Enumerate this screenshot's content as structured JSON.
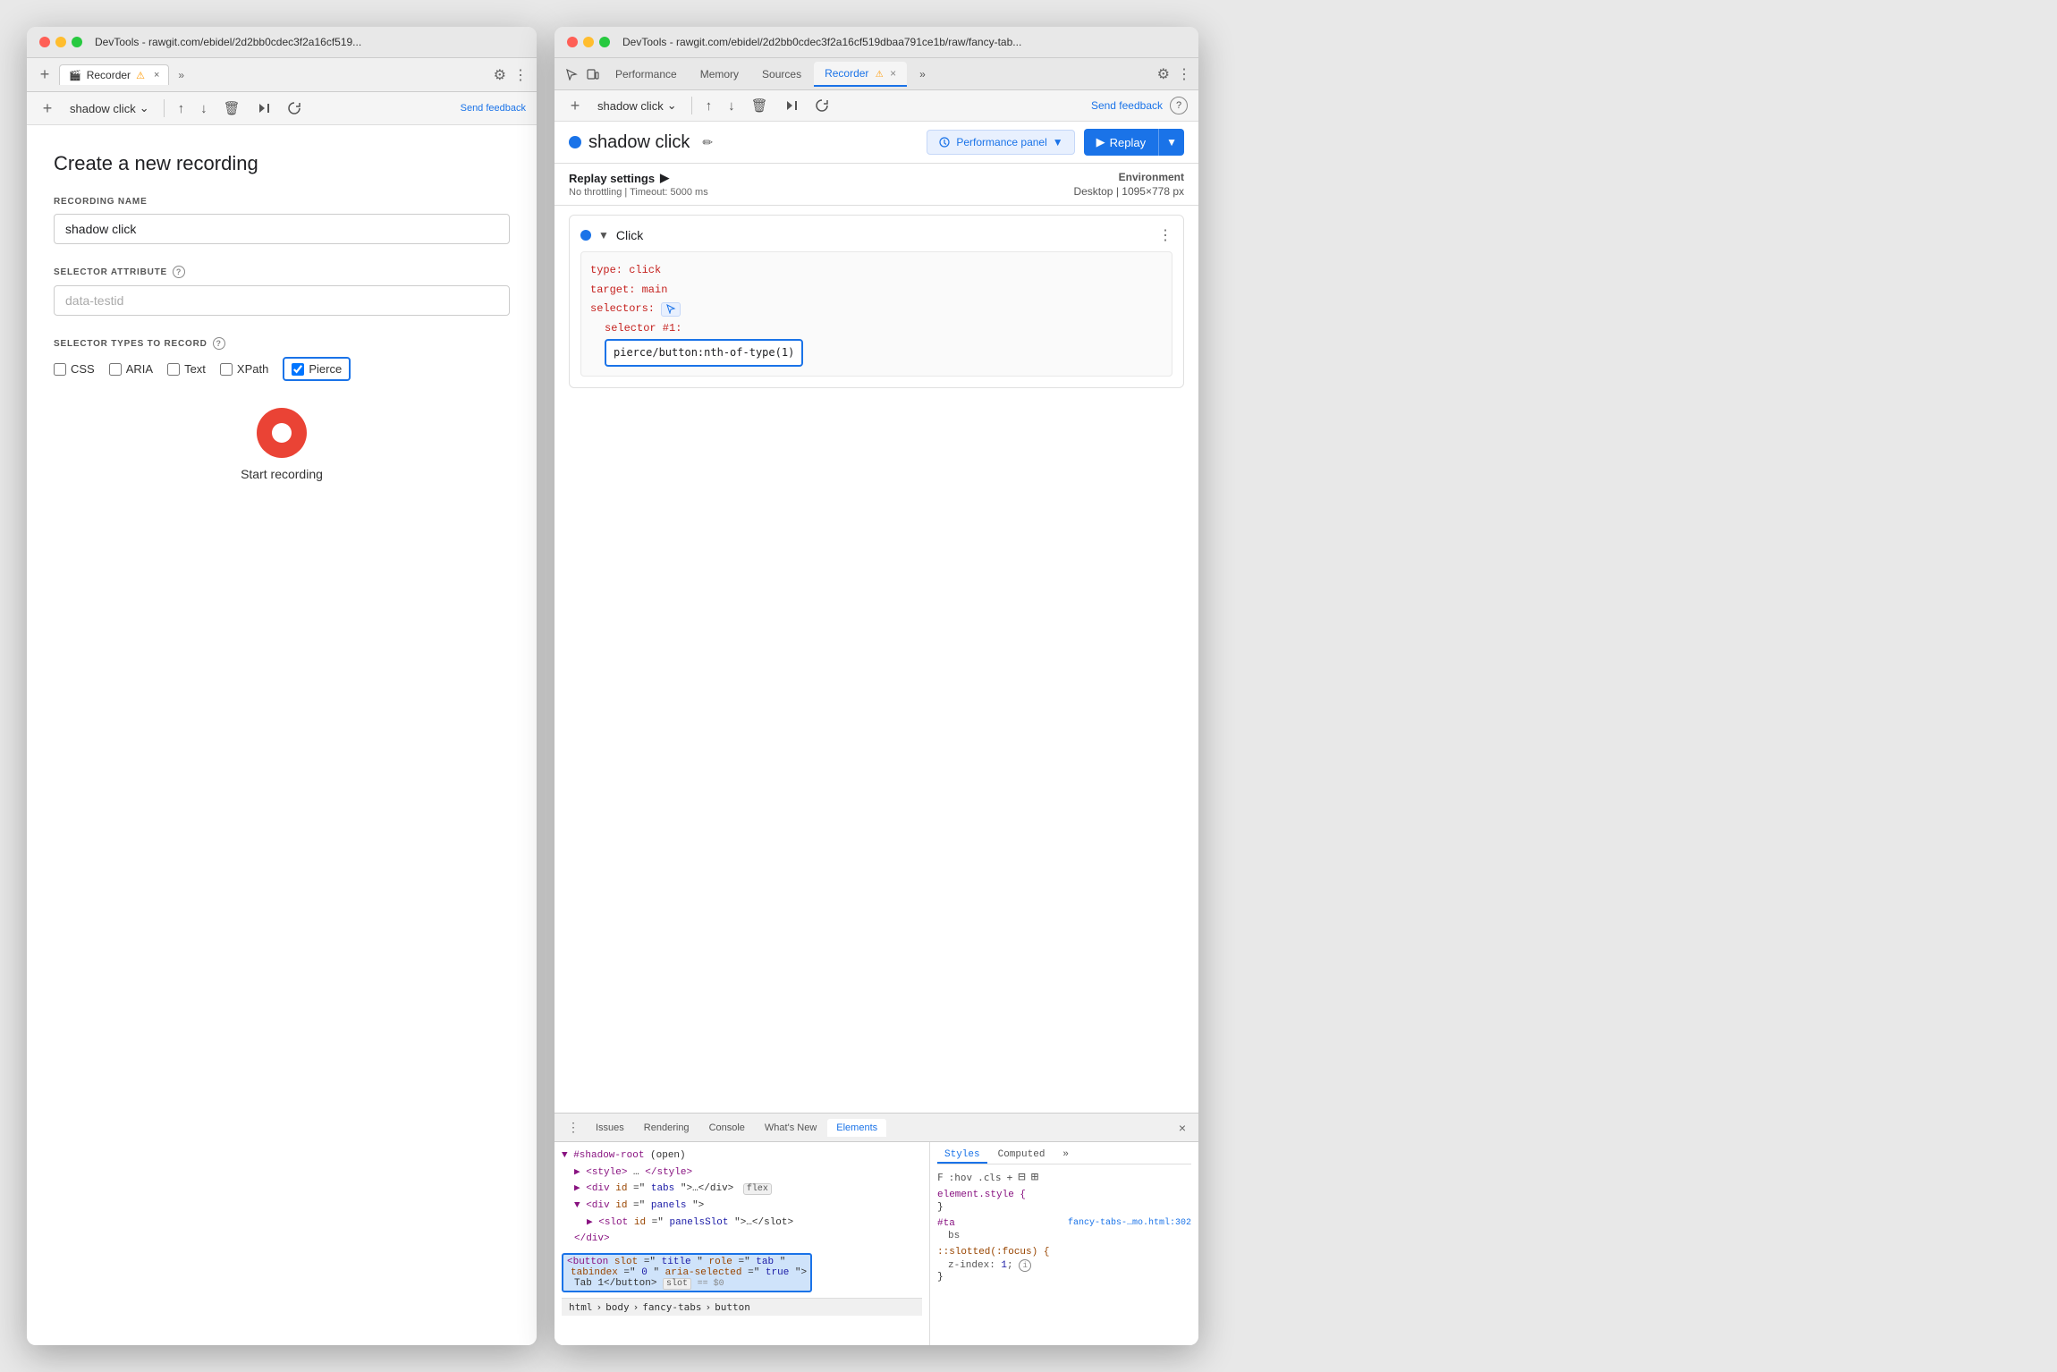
{
  "left_window": {
    "titlebar": "DevTools - rawgit.com/ebidel/2d2bb0cdec3f2a16cf519...",
    "tab_label": "Recorder",
    "tab_icon": "🎬",
    "recording_name_selector": "shadow click",
    "send_feedback": "Send\nfeedback",
    "create_title": "Create a new recording",
    "recording_name_label": "RECORDING NAME",
    "recording_name_value": "shadow click",
    "selector_attribute_label": "SELECTOR ATTRIBUTE",
    "selector_attribute_placeholder": "data-testid",
    "selector_types_label": "SELECTOR TYPES TO RECORD",
    "checkboxes": [
      {
        "id": "css",
        "label": "CSS",
        "checked": false
      },
      {
        "id": "aria",
        "label": "ARIA",
        "checked": false
      },
      {
        "id": "text",
        "label": "Text",
        "checked": false
      },
      {
        "id": "xpath",
        "label": "XPath",
        "checked": false
      },
      {
        "id": "pierce",
        "label": "Pierce",
        "checked": true
      }
    ],
    "start_recording_label": "Start recording"
  },
  "right_window": {
    "titlebar": "DevTools - rawgit.com/ebidel/2d2bb0cdec3f2a16cf519dbaa791ce1b/raw/fancy-tab...",
    "devtools_tabs": [
      "Performance",
      "Memory",
      "Sources",
      "Recorder",
      "»"
    ],
    "active_tab": "Recorder",
    "send_feedback": "Send feedback",
    "recording_name": "shadow click",
    "perf_panel_label": "Performance panel",
    "replay_label": "Replay",
    "replay_settings_title": "Replay settings",
    "no_throttling": "No throttling",
    "timeout": "Timeout: 5000 ms",
    "environment_label": "Environment",
    "environment_value": "Desktop",
    "env_size": "1095×778 px",
    "step_type": "Click",
    "code": {
      "type": "type: click",
      "target": "target: main",
      "selectors": "selectors:",
      "selector1_label": "selector #1:",
      "selector1_value": "pierce/button:nth-of-type(1)"
    }
  },
  "bottom_panel": {
    "tabs": [
      "Issues",
      "Rendering",
      "Console",
      "What's New",
      "Elements"
    ],
    "active_tab": "Elements",
    "html_elements": [
      "▼ #shadow-root (open)",
      "  ▶ <style>…</style>",
      "  ▶ <div id=\"tabs\">…</div>",
      "  ▼ <div id=\"panels\">",
      "    ▶ <slot id=\"panelsSlot\">…</slot>",
      "    </div>"
    ],
    "highlighted_element": "<button slot=\"title\" role=\"tab\"\n    tabindex=\"0\" aria-selected=\"true\">\n    Tab 1</button>",
    "slot_badge": "slot",
    "equals_dollar": "== $0",
    "breadcrumb": [
      "html",
      "body",
      "fancy-tabs",
      "button"
    ],
    "styles_tabs": [
      "Styles",
      "Computed",
      "»"
    ],
    "active_style_tab": "Styles",
    "filter_placeholder": "F",
    "hov_label": ":hov",
    "cls_label": ".cls",
    "element_style": "element.style {\n}",
    "rule1_selector": "#ta",
    "rule1_source": "fancy-tabs-…mo.html:302",
    "rule1_content": "bs",
    "pseudo_selector": "::slotted(:focus)",
    "pseudo_prop": "z-index: 1;",
    "rule_end": "}"
  },
  "icons": {
    "arrow_right": "▶",
    "arrow_down": "▼",
    "triangle_right": "▶",
    "pencil": "✏",
    "chevron_down": "⌄",
    "upload": "↑",
    "download": "↓",
    "delete": "🗑",
    "step_forward": "⏭",
    "refresh": "↺",
    "more_vert": "⋮",
    "close": "×",
    "add": "+",
    "play": "▶",
    "gear": "⚙",
    "cursor": "⌖",
    "panel": "⊞",
    "back": "←"
  }
}
